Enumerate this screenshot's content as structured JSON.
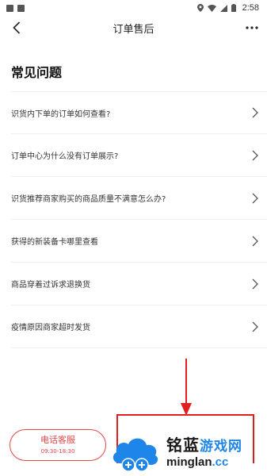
{
  "status_bar": {
    "time": "2:58",
    "icons": [
      "notification-box-icon",
      "notification-image-icon",
      "location-icon",
      "wifi-icon",
      "signal-icon",
      "battery-icon"
    ]
  },
  "nav": {
    "title": "订单售后",
    "back_icon": "chevron-left-icon",
    "more_icon": "more-dots-icon"
  },
  "faq": {
    "title": "常见问题",
    "items": [
      {
        "label": "识货内下单的订单如何查看?"
      },
      {
        "label": "订单中心为什么没有订单展示?"
      },
      {
        "label": "识货推荐商家购买的商品质量不满意怎么办?"
      },
      {
        "label": "获得的新装备卡哪里查看"
      },
      {
        "label": "商品穿着过诉求退换货"
      },
      {
        "label": "疫情原因商家超时发货"
      }
    ]
  },
  "contact": {
    "call_label": "电话客服",
    "call_hours": "09:30-18:30"
  },
  "watermark": {
    "cn_main": "铭蓝",
    "cn_accent": "游戏网",
    "en_main": "minglan",
    "en_accent": ".cc"
  },
  "colors": {
    "accent": "#e54545",
    "annotation": "#e02020",
    "watermark_blue": "#1e86e8"
  }
}
